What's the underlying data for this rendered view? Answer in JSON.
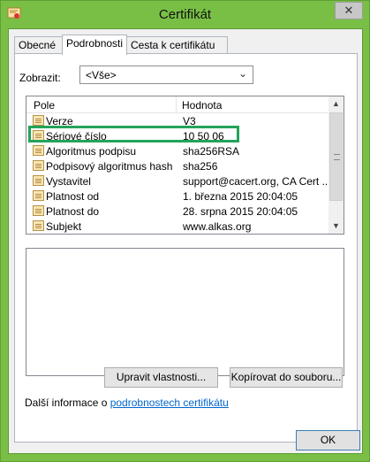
{
  "window": {
    "title": "Certifikát",
    "close_glyph": "✕"
  },
  "tabs": [
    {
      "label": "Obecné"
    },
    {
      "label": "Podrobnosti"
    },
    {
      "label": "Cesta k certifikátu"
    }
  ],
  "show": {
    "label": "Zobrazit:",
    "value": "<Vše>"
  },
  "list": {
    "headers": {
      "field": "Pole",
      "value": "Hodnota"
    },
    "rows": [
      {
        "field": "Verze",
        "value": "V3"
      },
      {
        "field": "Sériové číslo",
        "value": "10 50 06"
      },
      {
        "field": "Algoritmus podpisu",
        "value": "sha256RSA"
      },
      {
        "field": "Podpisový algoritmus hash",
        "value": "sha256"
      },
      {
        "field": "Vystavitel",
        "value": "support@cacert.org, CA Cert ..."
      },
      {
        "field": "Platnost od",
        "value": "1. března 2015 20:04:05"
      },
      {
        "field": "Platnost do",
        "value": "28. srpna 2015 20:04:05"
      },
      {
        "field": "Subjekt",
        "value": "www.alkas.org"
      }
    ]
  },
  "buttons": {
    "edit": "Upravit vlastnosti...",
    "copy": "Kopírovat do souboru...",
    "ok": "OK"
  },
  "info": {
    "prefix": "Další informace o ",
    "link": "podrobnostech certifikátu"
  },
  "colors": {
    "frame": "#79bf45",
    "highlight": "#24a35a",
    "link": "#0066cc"
  }
}
